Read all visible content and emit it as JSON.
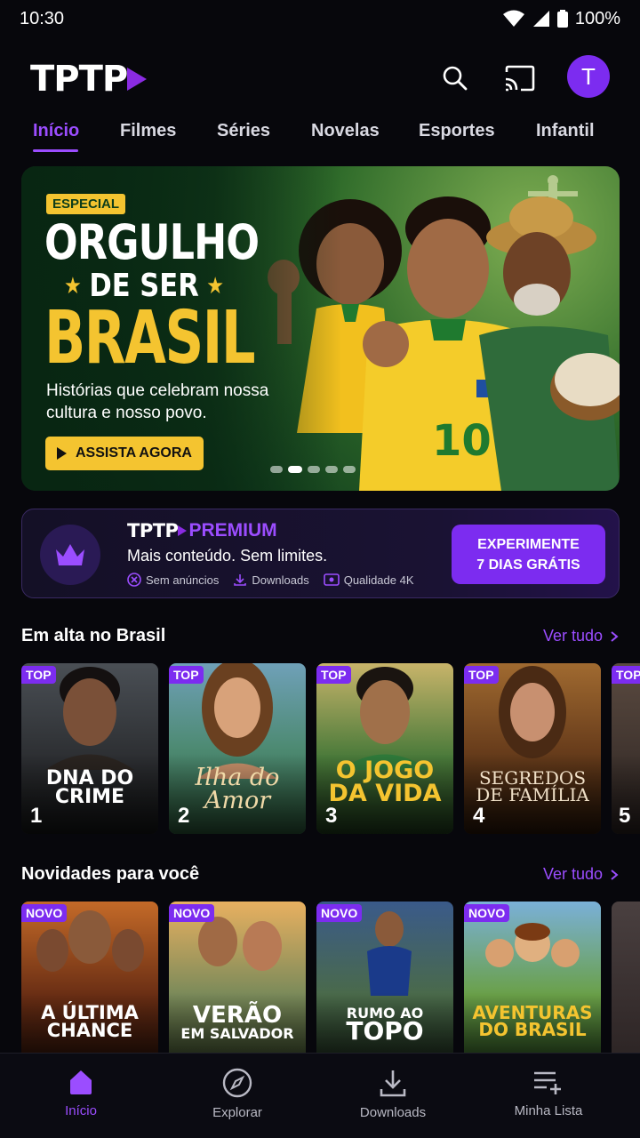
{
  "status": {
    "time": "10:30",
    "battery": "100%"
  },
  "header": {
    "logo": "TPTP",
    "avatar_letter": "T"
  },
  "tabs": [
    {
      "label": "Início",
      "active": true
    },
    {
      "label": "Filmes"
    },
    {
      "label": "Séries"
    },
    {
      "label": "Novelas"
    },
    {
      "label": "Esportes"
    },
    {
      "label": "Infantil"
    }
  ],
  "hero": {
    "badge": "ESPECIAL",
    "title_line1": "ORGULHO",
    "title_line2": "DE SER",
    "title_line3": "BRASIL",
    "description": "Histórias que celebram nossa cultura e nosso povo.",
    "cta": "ASSISTA AGORA",
    "jersey_number": "10",
    "slides": 5,
    "active_slide": 1
  },
  "premium": {
    "brand": "TPTP",
    "label": "PREMIUM",
    "subtitle": "Mais conteúdo. Sem limites.",
    "features": [
      "Sem anúncios",
      "Downloads",
      "Qualidade 4K"
    ],
    "button_line1": "EXPERIMENTE",
    "button_line2": "7 DIAS GRÁTIS"
  },
  "trending": {
    "title": "Em alta no Brasil",
    "see_all": "Ver tudo",
    "cards": [
      {
        "tag": "TOP",
        "title1": "DNA DO",
        "title2": "CRIME",
        "rank": "1"
      },
      {
        "tag": "TOP",
        "title1": "Ilha do",
        "title2": "Amor",
        "rank": "2"
      },
      {
        "tag": "TOP",
        "title1": "O JOGO",
        "title2": "DA VIDA",
        "rank": "3"
      },
      {
        "tag": "TOP",
        "title1": "SEGREDOS",
        "title2": "DE FAMÍLIA",
        "rank": "4"
      },
      {
        "tag": "TOP",
        "title1": "",
        "title2": "",
        "rank": "5"
      }
    ]
  },
  "new_for_you": {
    "title": "Novidades para você",
    "see_all": "Ver tudo",
    "cards": [
      {
        "tag": "NOVO",
        "title1": "A ÚLTIMA",
        "title2": "CHANCE"
      },
      {
        "tag": "NOVO",
        "title1": "VERÃO",
        "title2": "EM SALVADOR"
      },
      {
        "tag": "NOVO",
        "title1": "RUMO AO",
        "title2": "TOPO"
      },
      {
        "tag": "NOVO",
        "title1": "AVENTURAS",
        "title2": "DO BRASIL"
      }
    ]
  },
  "bottom_nav": [
    {
      "label": "Início",
      "icon": "home-icon",
      "active": true
    },
    {
      "label": "Explorar",
      "icon": "compass-icon"
    },
    {
      "label": "Downloads",
      "icon": "download-icon"
    },
    {
      "label": "Minha Lista",
      "icon": "playlist-add-icon"
    }
  ],
  "colors": {
    "accent": "#7c2cf0",
    "accent_text": "#9b4dff",
    "yellow": "#f4c430",
    "background": "#07070c"
  }
}
